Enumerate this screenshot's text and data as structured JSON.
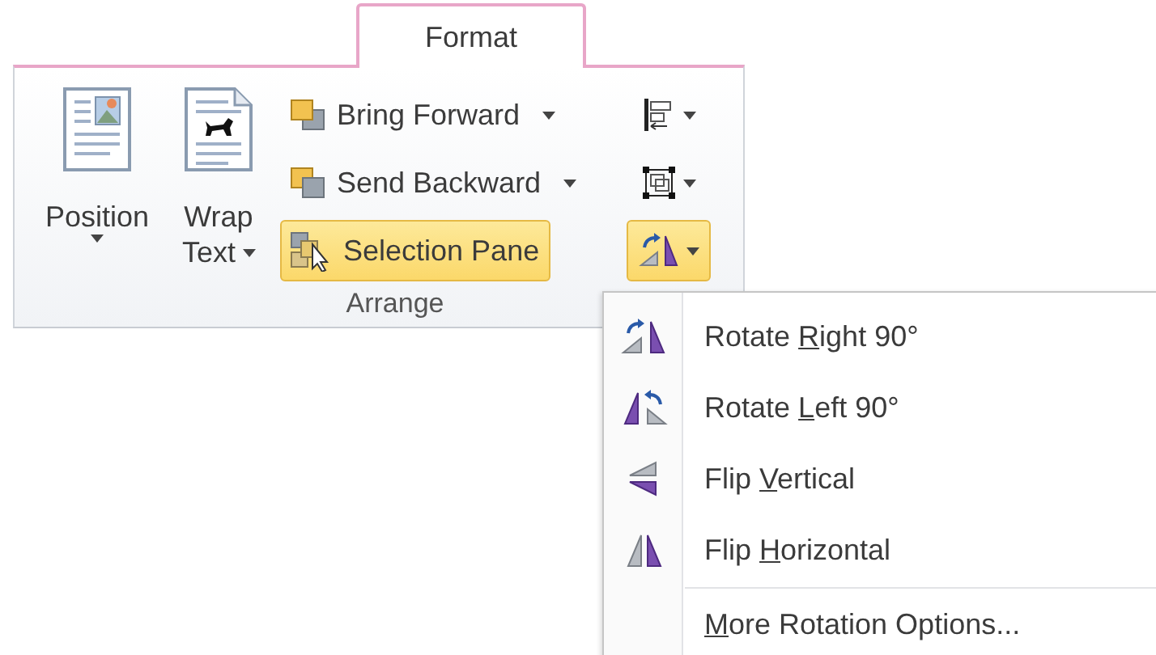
{
  "tab": {
    "label": "Format",
    "selected": true
  },
  "group": {
    "label": "Arrange"
  },
  "large_buttons": [
    {
      "kind": "position",
      "lines": [
        "Position"
      ]
    },
    {
      "kind": "wrap",
      "lines": [
        "Wrap",
        "Text"
      ]
    }
  ],
  "small_buttons": [
    {
      "kind": "bring-forward",
      "label": "Bring Forward",
      "dropdown": true,
      "highlighted": false
    },
    {
      "kind": "send-backward",
      "label": "Send Backward",
      "dropdown": true,
      "highlighted": false
    },
    {
      "kind": "selection-pane",
      "label": "Selection Pane",
      "dropdown": false,
      "highlighted": true
    }
  ],
  "icon_buttons": [
    {
      "kind": "align",
      "highlighted": false
    },
    {
      "kind": "group",
      "highlighted": false
    },
    {
      "kind": "rotate",
      "highlighted": true
    }
  ],
  "menu": {
    "items": [
      {
        "kind": "rotate-right",
        "before": "Rotate ",
        "key": "R",
        "after": "ight 90°"
      },
      {
        "kind": "rotate-left",
        "before": "Rotate ",
        "key": "L",
        "after": "eft 90°"
      },
      {
        "kind": "flip-vertical",
        "before": "Flip ",
        "key": "V",
        "after": "ertical"
      },
      {
        "kind": "flip-horizontal",
        "before": "Flip ",
        "key": "H",
        "after": "orizontal"
      },
      {
        "kind": "more",
        "key": "M",
        "after": "ore Rotation Options..."
      }
    ]
  }
}
